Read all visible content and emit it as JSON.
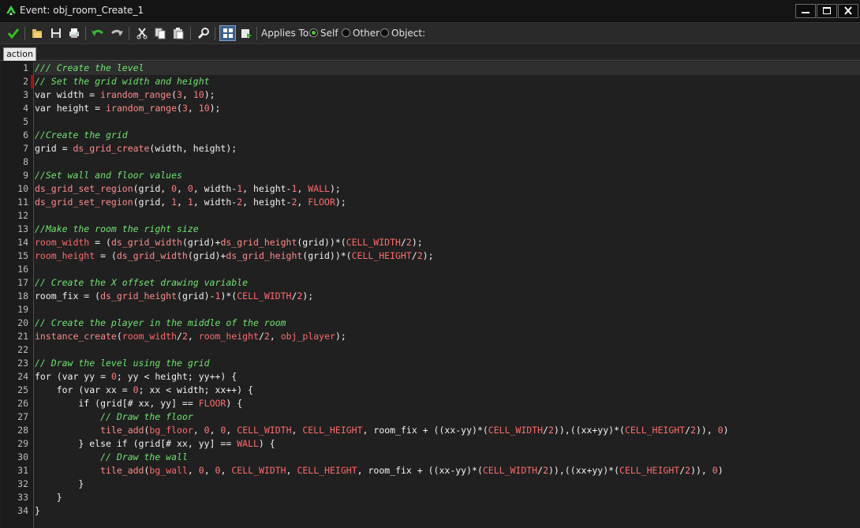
{
  "window": {
    "title": "Event: obj_room_Create_1",
    "icon": "gamemaker-logo-icon",
    "controls": [
      "minimize-icon",
      "maximize-icon",
      "close-icon"
    ]
  },
  "toolbar": {
    "buttons": [
      {
        "icon": "checkmark-icon"
      },
      {
        "icon": "open-folder-icon"
      },
      {
        "icon": "save-icon"
      },
      {
        "icon": "print-icon"
      },
      {
        "icon": "undo-icon"
      },
      {
        "icon": "redo-icon"
      },
      {
        "icon": "cut-icon"
      },
      {
        "icon": "copy-icon"
      },
      {
        "icon": "paste-icon"
      },
      {
        "icon": "find-icon"
      },
      {
        "icon": "syntax-check-icon"
      },
      {
        "icon": "test-icon"
      }
    ],
    "applies_to_label": "Applies To:",
    "options": [
      {
        "label": "Self",
        "selected": true
      },
      {
        "label": "Other",
        "selected": false
      },
      {
        "label": "Object:",
        "selected": false
      }
    ]
  },
  "tabs": [
    {
      "label": "action",
      "active": true
    }
  ],
  "colors": {
    "comment": "#6fe36f",
    "function": "#ff8b8b",
    "constant": "#ff6a6a",
    "number": "#ff7b7b",
    "default": "#f2f2f2",
    "breakpoint": "#a01010"
  },
  "editor": {
    "current_line": 1,
    "lines": [
      [
        {
          "t": "/// Create the level",
          "c": "cm"
        }
      ],
      [
        {
          "t": "// Set the grid width and height",
          "c": "cm"
        }
      ],
      [
        {
          "t": "var width = "
        },
        {
          "t": "irandom_range",
          "c": "fn"
        },
        {
          "t": "("
        },
        {
          "t": "3",
          "c": "nm"
        },
        {
          "t": ", "
        },
        {
          "t": "10",
          "c": "nm"
        },
        {
          "t": ");"
        }
      ],
      [
        {
          "t": "var height = "
        },
        {
          "t": "irandom_range",
          "c": "fn"
        },
        {
          "t": "("
        },
        {
          "t": "3",
          "c": "nm"
        },
        {
          "t": ", "
        },
        {
          "t": "10",
          "c": "nm"
        },
        {
          "t": ");"
        }
      ],
      [],
      [
        {
          "t": "//Create the grid",
          "c": "cm"
        }
      ],
      [
        {
          "t": "grid = "
        },
        {
          "t": "ds_grid_create",
          "c": "fn"
        },
        {
          "t": "(width, height);"
        }
      ],
      [],
      [
        {
          "t": "//Set wall and floor values",
          "c": "cm"
        }
      ],
      [
        {
          "t": "ds_grid_set_region",
          "c": "fn"
        },
        {
          "t": "(grid, "
        },
        {
          "t": "0",
          "c": "nm"
        },
        {
          "t": ", "
        },
        {
          "t": "0",
          "c": "nm"
        },
        {
          "t": ", width-"
        },
        {
          "t": "1",
          "c": "nm"
        },
        {
          "t": ", height-"
        },
        {
          "t": "1",
          "c": "nm"
        },
        {
          "t": ", "
        },
        {
          "t": "WALL",
          "c": "cs"
        },
        {
          "t": ");"
        }
      ],
      [
        {
          "t": "ds_grid_set_region",
          "c": "fn"
        },
        {
          "t": "(grid, "
        },
        {
          "t": "1",
          "c": "nm"
        },
        {
          "t": ", "
        },
        {
          "t": "1",
          "c": "nm"
        },
        {
          "t": ", width-"
        },
        {
          "t": "2",
          "c": "nm"
        },
        {
          "t": ", height-"
        },
        {
          "t": "2",
          "c": "nm"
        },
        {
          "t": ", "
        },
        {
          "t": "FLOOR",
          "c": "cs"
        },
        {
          "t": ");"
        }
      ],
      [],
      [
        {
          "t": "//Make the room the right size",
          "c": "cm"
        }
      ],
      [
        {
          "t": "room_width",
          "c": "cs"
        },
        {
          "t": " = ("
        },
        {
          "t": "ds_grid_width",
          "c": "fn"
        },
        {
          "t": "(grid)+"
        },
        {
          "t": "ds_grid_height",
          "c": "fn"
        },
        {
          "t": "(grid))*("
        },
        {
          "t": "CELL_WIDTH",
          "c": "cs"
        },
        {
          "t": "/"
        },
        {
          "t": "2",
          "c": "nm"
        },
        {
          "t": ");"
        }
      ],
      [
        {
          "t": "room_height",
          "c": "cs"
        },
        {
          "t": " = ("
        },
        {
          "t": "ds_grid_width",
          "c": "fn"
        },
        {
          "t": "(grid)+"
        },
        {
          "t": "ds_grid_height",
          "c": "fn"
        },
        {
          "t": "(grid))*("
        },
        {
          "t": "CELL_HEIGHT",
          "c": "cs"
        },
        {
          "t": "/"
        },
        {
          "t": "2",
          "c": "nm"
        },
        {
          "t": ");"
        }
      ],
      [],
      [
        {
          "t": "// Create the X offset drawing variable",
          "c": "cm"
        }
      ],
      [
        {
          "t": "room_fix = ("
        },
        {
          "t": "ds_grid_height",
          "c": "fn"
        },
        {
          "t": "(grid)-"
        },
        {
          "t": "1",
          "c": "nm"
        },
        {
          "t": ")*("
        },
        {
          "t": "CELL_WIDTH",
          "c": "cs"
        },
        {
          "t": "/"
        },
        {
          "t": "2",
          "c": "nm"
        },
        {
          "t": ");"
        }
      ],
      [],
      [
        {
          "t": "// Create the player in the middle of the room",
          "c": "cm"
        }
      ],
      [
        {
          "t": "instance_create",
          "c": "fn"
        },
        {
          "t": "("
        },
        {
          "t": "room_width",
          "c": "cs"
        },
        {
          "t": "/"
        },
        {
          "t": "2",
          "c": "nm"
        },
        {
          "t": ", "
        },
        {
          "t": "room_height",
          "c": "cs"
        },
        {
          "t": "/"
        },
        {
          "t": "2",
          "c": "nm"
        },
        {
          "t": ", "
        },
        {
          "t": "obj_player",
          "c": "cs"
        },
        {
          "t": ");"
        }
      ],
      [],
      [
        {
          "t": "// Draw the level using the grid",
          "c": "cm"
        }
      ],
      [
        {
          "t": "for (var yy = "
        },
        {
          "t": "0",
          "c": "nm"
        },
        {
          "t": "; yy < height; yy++) {"
        }
      ],
      [
        {
          "t": "    for (var xx = "
        },
        {
          "t": "0",
          "c": "nm"
        },
        {
          "t": "; xx < width; xx++) {"
        }
      ],
      [
        {
          "t": "        if (grid[# xx, yy] == "
        },
        {
          "t": "FLOOR",
          "c": "cs"
        },
        {
          "t": ") {"
        }
      ],
      [
        {
          "t": "            "
        },
        {
          "t": "// Draw the floor",
          "c": "cm"
        }
      ],
      [
        {
          "t": "            "
        },
        {
          "t": "tile_add",
          "c": "fn"
        },
        {
          "t": "("
        },
        {
          "t": "bg_floor",
          "c": "cs"
        },
        {
          "t": ", "
        },
        {
          "t": "0",
          "c": "nm"
        },
        {
          "t": ", "
        },
        {
          "t": "0",
          "c": "nm"
        },
        {
          "t": ", "
        },
        {
          "t": "CELL_WIDTH",
          "c": "cs"
        },
        {
          "t": ", "
        },
        {
          "t": "CELL_HEIGHT",
          "c": "cs"
        },
        {
          "t": ", room_fix + ((xx-yy)*("
        },
        {
          "t": "CELL_WIDTH",
          "c": "cs"
        },
        {
          "t": "/"
        },
        {
          "t": "2",
          "c": "nm"
        },
        {
          "t": ")),((xx+yy)*("
        },
        {
          "t": "CELL_HEIGHT",
          "c": "cs"
        },
        {
          "t": "/"
        },
        {
          "t": "2",
          "c": "nm"
        },
        {
          "t": ")), "
        },
        {
          "t": "0",
          "c": "nm"
        },
        {
          "t": ")"
        }
      ],
      [
        {
          "t": "        } else if (grid[# xx, yy] == "
        },
        {
          "t": "WALL",
          "c": "cs"
        },
        {
          "t": ") {"
        }
      ],
      [
        {
          "t": "            "
        },
        {
          "t": "// Draw the wall",
          "c": "cm"
        }
      ],
      [
        {
          "t": "            "
        },
        {
          "t": "tile_add",
          "c": "fn"
        },
        {
          "t": "("
        },
        {
          "t": "bg_wall",
          "c": "cs"
        },
        {
          "t": ", "
        },
        {
          "t": "0",
          "c": "nm"
        },
        {
          "t": ", "
        },
        {
          "t": "0",
          "c": "nm"
        },
        {
          "t": ", "
        },
        {
          "t": "CELL_WIDTH",
          "c": "cs"
        },
        {
          "t": ", "
        },
        {
          "t": "CELL_HEIGHT",
          "c": "cs"
        },
        {
          "t": ", room_fix + ((xx-yy)*("
        },
        {
          "t": "CELL_WIDTH",
          "c": "cs"
        },
        {
          "t": "/"
        },
        {
          "t": "2",
          "c": "nm"
        },
        {
          "t": ")),((xx+yy)*("
        },
        {
          "t": "CELL_HEIGHT",
          "c": "cs"
        },
        {
          "t": "/"
        },
        {
          "t": "2",
          "c": "nm"
        },
        {
          "t": ")), "
        },
        {
          "t": "0",
          "c": "nm"
        },
        {
          "t": ")"
        }
      ],
      [
        {
          "t": "        }"
        }
      ],
      [
        {
          "t": "    }"
        }
      ],
      [
        {
          "t": "}"
        }
      ]
    ]
  }
}
